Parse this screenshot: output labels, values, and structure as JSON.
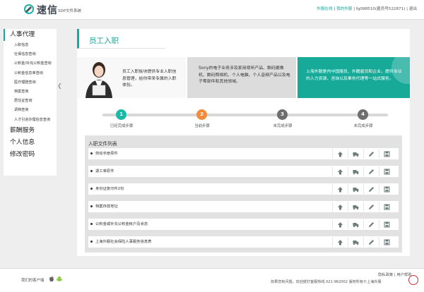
{
  "header": {
    "logo_text": "速信",
    "logo_subtitle": "SDP文件系统",
    "links": [
      "外服在线",
      "我的外服",
      "fg098510(雇员号522871)",
      "退出"
    ],
    "separator": "|"
  },
  "sidebar": {
    "sections": [
      {
        "label": "人事代理",
        "items": [
          "入职信息",
          "社保信息查询",
          "公积金/补充公积金查询",
          "公积金信息单查询",
          "医疗理赔查询",
          "档案查询",
          "居住证查询",
          "调档查询",
          "人才引进办理信息查询"
        ]
      },
      {
        "label": "薪酬服务",
        "items": []
      },
      {
        "label": "个人信息",
        "items": []
      },
      {
        "label": "修改密码",
        "items": []
      }
    ]
  },
  "main": {
    "title": "员工入职",
    "banners": [
      "员工入职板块提供专业入职信息管理，给你带来专属的入职体验。",
      "Sony的电子业务涉及家用视听产品、数码摄像机、数码照相机、个人电脑、个人音频产品以及电子零部件和其他领域。",
      "上海外服是内中国服员、外籍雇员和企业，提供专业的人力资源、咨询以及事务代理等一站式服务。"
    ],
    "steps": [
      {
        "num": "1",
        "label": "已经完成步骤",
        "color": "#1cb9a7"
      },
      {
        "num": "2",
        "label": "当前步骤",
        "color": "#f28c3c"
      },
      {
        "num": "3",
        "label": "未完成步骤",
        "color": "#6e6e6e"
      },
      {
        "num": "4",
        "label": "未完成步骤",
        "color": "#6e6e6e"
      }
    ],
    "list_title": "入职文件列表",
    "files": [
      "劳动手册原件",
      "退工单原件",
      "身份证复印件2份",
      "档案存放地址",
      "公积金或补充公积金帐户及状态",
      "上海外服社会保险人事服务信息表"
    ],
    "action_icons": [
      "upload-icon",
      "truck-icon",
      "edit-icon",
      "save-icon"
    ],
    "colors": {
      "accent": "#17a79c",
      "banner_teal": "#17aa99",
      "icon_gray": "#6a7b7a"
    }
  },
  "footer": {
    "client_label": "我们的客户端",
    "links": "隐私政策 | 用户帮助",
    "contact": "如果您有问题，欢迎拨打客服热线 021-962002 版权所有©上海外服"
  }
}
